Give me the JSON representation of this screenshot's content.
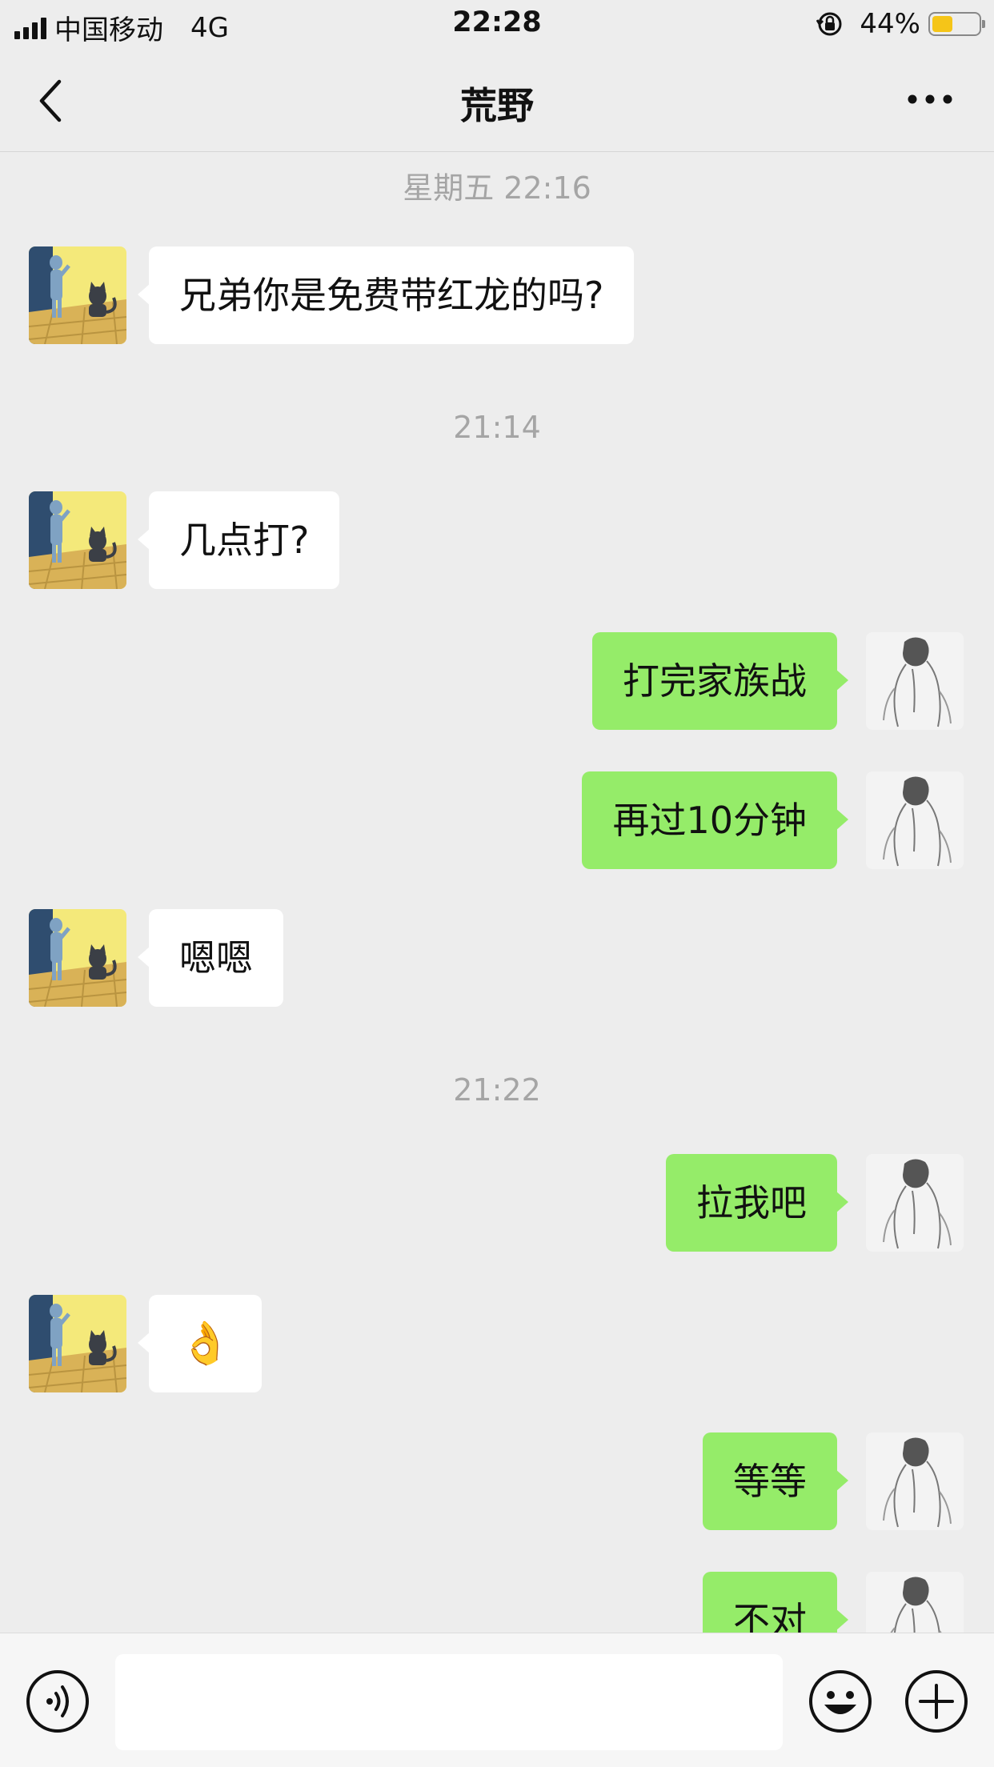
{
  "status_bar": {
    "carrier": "中国移动",
    "network": "4G",
    "time": "22:28",
    "battery_percent": "44%",
    "battery_level": 0.44,
    "battery_color": "#f5c518"
  },
  "nav": {
    "title": "荒野",
    "back_icon": "chevron-left-icon",
    "more_icon": "more-dots-icon"
  },
  "timestamps": [
    "星期五 22:16",
    "21:14",
    "21:22"
  ],
  "messages": [
    {
      "side": "in",
      "text": "兄弟你是免费带红龙的吗?"
    },
    {
      "side": "in",
      "text": "几点打?"
    },
    {
      "side": "out",
      "text": "打完家族战"
    },
    {
      "side": "out",
      "text": "再过10分钟"
    },
    {
      "side": "in",
      "text": "嗯嗯"
    },
    {
      "side": "out",
      "text": "拉我吧"
    },
    {
      "side": "in",
      "text": "👌"
    },
    {
      "side": "out",
      "text": "等等"
    },
    {
      "side": "out",
      "text": "不对"
    }
  ],
  "input_bar": {
    "voice_icon": "voice-icon",
    "emoji_icon": "emoji-icon",
    "plus_icon": "plus-icon",
    "input_value": ""
  },
  "colors": {
    "background": "#ededed",
    "incoming_bubble": "#ffffff",
    "outgoing_bubble": "#95ec69",
    "timestamp": "#a5a5a5"
  }
}
